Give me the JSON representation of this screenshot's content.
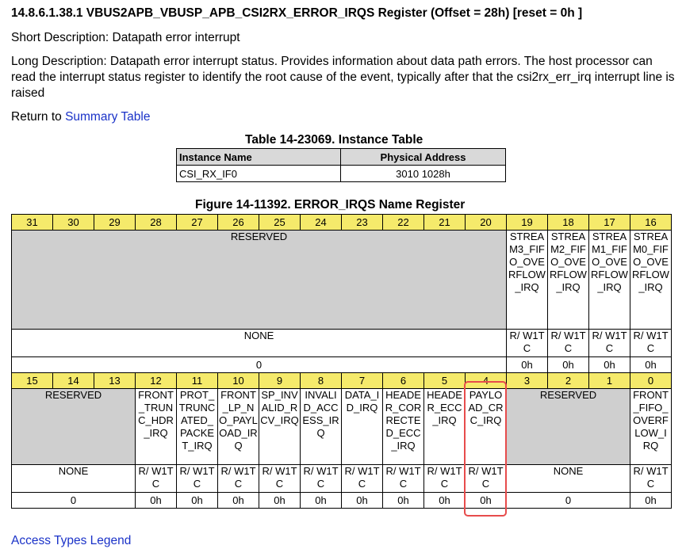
{
  "title": "14.8.6.1.38.1 VBUS2APB_VBUSP_APB_CSI2RX_ERROR_IRQS Register (Offset = 28h) [reset = 0h ]",
  "short_desc": "Short Description: Datapath error interrupt",
  "long_desc": "Long Description: Datapath error interrupt status. Provides information about data path errors. The host processor can read the interrupt status register to identify the root cause of the event, typically after that the csi2rx_err_irq interrupt line is raised",
  "return_prefix": "Return to ",
  "return_link": "Summary Table",
  "instance_table": {
    "caption": "Table 14-23069. Instance Table",
    "headers": [
      "Instance Name",
      "Physical Address"
    ],
    "rows": [
      [
        "CSI_RX_IF0",
        "3010 1028h"
      ]
    ]
  },
  "figure_caption": "Figure 14-11392. ERROR_IRQS Name Register",
  "upper": {
    "bits": [
      "31",
      "30",
      "29",
      "28",
      "27",
      "26",
      "25",
      "24",
      "23",
      "22",
      "21",
      "20",
      "19",
      "18",
      "17",
      "16"
    ],
    "fields": [
      {
        "name": "RESERVED",
        "access": "NONE",
        "reset": "0",
        "span": 12,
        "reserved": true
      },
      {
        "name": "STREAM3_FIFO_OVERFLOW_IRQ",
        "access": "R/ W1TC",
        "reset": "0h",
        "span": 1
      },
      {
        "name": "STREAM2_FIFO_OVERFLOW_IRQ",
        "access": "R/ W1TC",
        "reset": "0h",
        "span": 1
      },
      {
        "name": "STREAM1_FIFO_OVERFLOW_IRQ",
        "access": "R/ W1TC",
        "reset": "0h",
        "span": 1
      },
      {
        "name": "STREAM0_FIFO_OVERFLOW_IRQ",
        "access": "R/ W1TC",
        "reset": "0h",
        "span": 1
      }
    ]
  },
  "lower": {
    "bits": [
      "15",
      "14",
      "13",
      "12",
      "11",
      "10",
      "9",
      "8",
      "7",
      "6",
      "5",
      "4",
      "3",
      "2",
      "1",
      "0"
    ],
    "fields": [
      {
        "name": "RESERVED",
        "access": "NONE",
        "reset": "0",
        "span": 3,
        "reserved": true
      },
      {
        "name": "FRONT_TRUNC_HDR_IRQ",
        "access": "R/ W1TC",
        "reset": "0h",
        "span": 1
      },
      {
        "name": "PROT_TRUNCATED_PACKET_IRQ",
        "access": "R/ W1TC",
        "reset": "0h",
        "span": 1
      },
      {
        "name": "FRONT_LP_NO_PAYLOAD_IRQ",
        "access": "R/ W1TC",
        "reset": "0h",
        "span": 1
      },
      {
        "name": "SP_INVALID_RCV_IRQ",
        "access": "R/ W1TC",
        "reset": "0h",
        "span": 1
      },
      {
        "name": "INVALID_ACCESS_IRQ",
        "access": "R/ W1TC",
        "reset": "0h",
        "span": 1
      },
      {
        "name": "DATA_ID_IRQ",
        "access": "R/ W1TC",
        "reset": "0h",
        "span": 1
      },
      {
        "name": "HEADER_CORRECTED_ECC_IRQ",
        "access": "R/ W1TC",
        "reset": "0h",
        "span": 1
      },
      {
        "name": "HEADER_ECC_IRQ",
        "access": "R/ W1TC",
        "reset": "0h",
        "span": 1
      },
      {
        "name": "PAYLOAD_CRC_IRQ",
        "access": "R/ W1TC",
        "reset": "0h",
        "span": 1
      },
      {
        "name": "RESERVED",
        "access": "NONE",
        "reset": "0",
        "span": 3,
        "reserved": true
      },
      {
        "name": "FRONT_FIFO_OVERFLOW_IRQ",
        "access": "R/ W1TC",
        "reset": "0h",
        "span": 1
      }
    ]
  },
  "legend_link": "Access Types Legend",
  "highlight_color": "#e74c4c"
}
